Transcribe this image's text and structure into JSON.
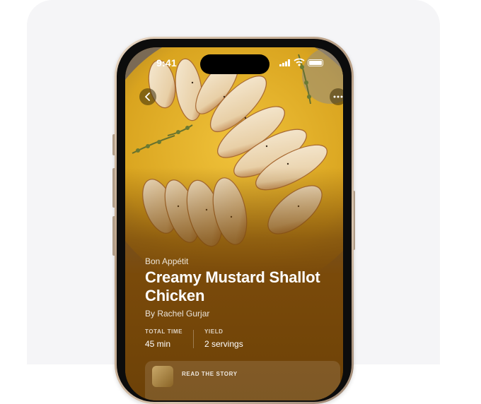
{
  "status_bar": {
    "time": "9:41"
  },
  "recipe": {
    "publisher": "Bon Appétit",
    "title_line1": "Creamy Mustard Shallot",
    "title_line2": "Chicken",
    "author": "By Rachel Gurjar"
  },
  "stats": [
    {
      "label": "TOTAL TIME",
      "value": "45 min"
    },
    {
      "label": "YIELD",
      "value": "2 servings"
    }
  ],
  "story": {
    "label": "READ THE STORY"
  },
  "icons": {
    "back": "chevron-left-icon",
    "more": "ellipsis-icon",
    "signal": "cellular-signal-icon",
    "wifi": "wifi-icon",
    "battery": "battery-icon"
  },
  "colors": {
    "sauce": "#d9a41f",
    "card_background": "#6c4107",
    "text": "#ffffff"
  }
}
